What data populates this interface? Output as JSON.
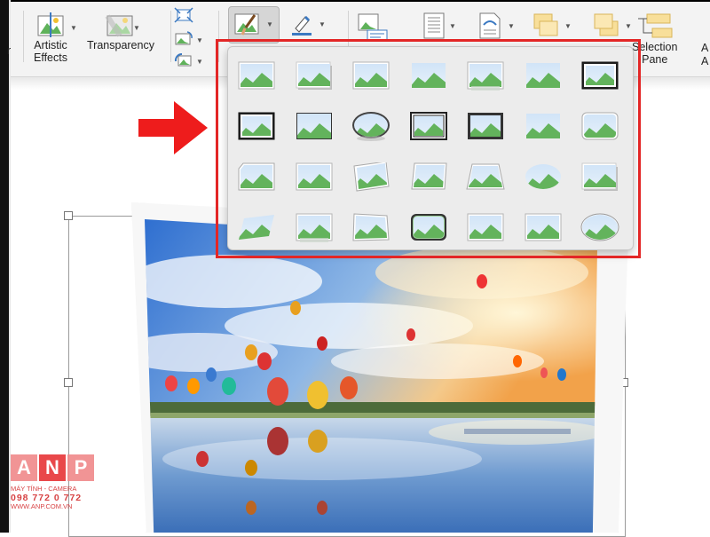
{
  "ribbon": {
    "partial_label": "r",
    "artistic_label_line1": "Artistic",
    "artistic_label_line2": "Effects",
    "transparency_label": "Transparency",
    "selection_label_line1": "Selection",
    "selection_label_line2": "Pane",
    "partial_right_top": "A",
    "partial_right_bottom": "A"
  },
  "gallery": {
    "rows": 4,
    "columns": 7,
    "selected_index": 0
  },
  "watermark": {
    "letters": [
      "A",
      "N",
      "P"
    ],
    "line1": "MÁY TÍNH - CAMERA",
    "line2": "098 772 0 772",
    "line3": "WWW.ANP.COM.VN"
  },
  "colors": {
    "highlight_red": "#e32626",
    "ribbon_bg": "#f3f3f3",
    "gallery_bg": "#ececec",
    "brand_red": "#e8393b"
  }
}
